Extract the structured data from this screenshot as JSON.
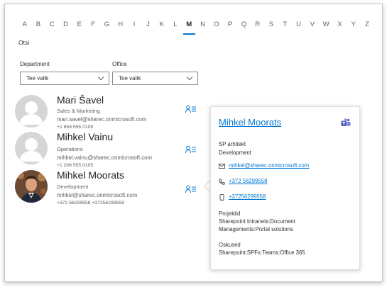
{
  "alphabet": [
    "A",
    "B",
    "C",
    "D",
    "E",
    "F",
    "G",
    "H",
    "I",
    "J",
    "K",
    "L",
    "M",
    "N",
    "O",
    "P",
    "Q",
    "R",
    "S",
    "T",
    "U",
    "V",
    "W",
    "X",
    "Y",
    "Z"
  ],
  "active_letter": "M",
  "search": {
    "label": "Otsi"
  },
  "filters": {
    "department": {
      "label": "Department",
      "value": "Tee valik"
    },
    "office": {
      "label": "Office",
      "value": "Tee valik"
    }
  },
  "people": [
    {
      "name": "Mari Šavel",
      "department": "Sales & Marketing",
      "email": "mari.savel@sharec.onmicrosoft.com",
      "phone": "+1 858 555 0109",
      "avatar": "person-placeholder-icon"
    },
    {
      "name": "Mihkel Vainu",
      "department": "Operations",
      "email": "mihkel.vainu@sharec.onmicrosoft.com",
      "phone": "+1 206 555 0105",
      "avatar": "person-placeholder-icon"
    },
    {
      "name": "Mihkel Moorats",
      "department": "Development",
      "email": "mihkel@sharec.onmicrosoft.com",
      "phone": "+372 56299558 +37256299558",
      "avatar": "photo"
    }
  ],
  "card": {
    "name": "Mihkel Moorats",
    "title": "SP arhitekt",
    "department": "Development",
    "email": "mihkel@sharec.onmicrosoft.com",
    "phone": "+372 56299558",
    "mobile": "+37256299558",
    "projects_label": "Projektid",
    "projects_line1": "Sharepoint Intranets:Document",
    "projects_line2": "Managements:Portal solutions",
    "skills_label": "Oskused",
    "skills": "Sharepoint:SPFx:Teams:Office 365"
  },
  "colors": {
    "accent": "#0078d4",
    "text": "#323130",
    "muted": "#605e5c"
  }
}
